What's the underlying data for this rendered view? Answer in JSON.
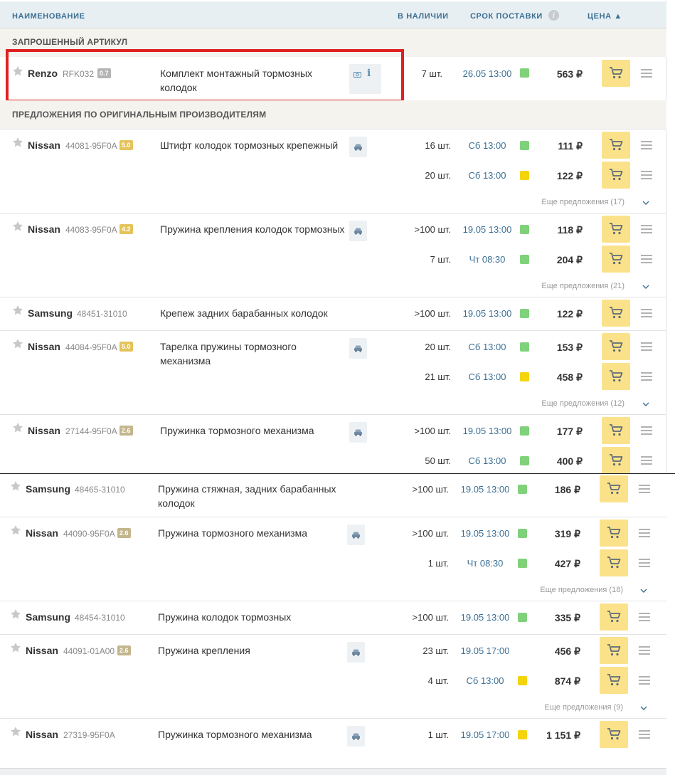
{
  "header": {
    "name": "НАИМЕНОВАНИЕ",
    "stock": "В НАЛИЧИИ",
    "delivery": "СРОК ПОСТАВКИ",
    "price": "ЦЕНА ▲"
  },
  "sections": {
    "requested": "ЗАПРОШЕННЫЙ АРТИКУЛ",
    "original": "ПРЕДЛОЖЕНИЯ ПО ОРИГИНАЛЬНЫМ ПРОИЗВОДИТЕЛЯМ"
  },
  "requested": {
    "brand": "Renzo",
    "code": "RFK032",
    "rating": "0.7",
    "desc": "Комплект монтажный тормозных колодок",
    "qty": "7 шт.",
    "date": "26.05 13:00",
    "price": "563 ₽"
  },
  "rows": [
    {
      "brand": "Nissan",
      "code": "44081-95F0A",
      "rating": "5.0",
      "desc": "Штифт колодок тормозных крепежный",
      "offers": [
        {
          "qty": "16 шт.",
          "date": "Сб 13:00",
          "price": "111 ₽"
        },
        {
          "qty": "20 шт.",
          "date": "Сб 13:00",
          "price": "122 ₽"
        }
      ],
      "more": "Еще предложения (17)"
    },
    {
      "brand": "Nissan",
      "code": "44083-95F0A",
      "rating": "4.2",
      "desc": "Пружина крепления колодок тормозных",
      "offers": [
        {
          "qty": ">100 шт.",
          "date": "19.05 13:00",
          "price": "118 ₽"
        },
        {
          "qty": "7 шт.",
          "date": "Чт 08:30",
          "price": "204 ₽"
        }
      ],
      "more": "Еще предложения (21)"
    },
    {
      "brand": "Samsung",
      "code": "48451-31010",
      "desc": "Крепеж задних барабанных колодок",
      "offers": [
        {
          "qty": ">100 шт.",
          "date": "19.05 13:00",
          "price": "122 ₽"
        }
      ]
    },
    {
      "brand": "Nissan",
      "code": "44084-95F0A",
      "rating": "5.0",
      "desc": "Тарелка пружины тормозного механизма",
      "offers": [
        {
          "qty": "20 шт.",
          "date": "Сб 13:00",
          "price": "153 ₽"
        },
        {
          "qty": "21 шт.",
          "date": "Сб 13:00",
          "price": "458 ₽"
        }
      ],
      "more": "Еще предложения (12)"
    },
    {
      "brand": "Nissan",
      "code": "27144-95F0A",
      "rating": "2.6",
      "desc": "Пружинка тормозного механизма",
      "offers": [
        {
          "qty": ">100 шт.",
          "date": "19.05 13:00",
          "price": "177 ₽"
        },
        {
          "qty": "50 шт.",
          "date": "Сб 13:00",
          "price": "400 ₽"
        }
      ]
    },
    {
      "brand": "Samsung",
      "code": "48465-31010",
      "desc": "Пружина стяжная, задних барабанных колодок",
      "offers": [
        {
          "qty": ">100 шт.",
          "date": "19.05 13:00",
          "price": "186 ₽"
        }
      ]
    },
    {
      "brand": "Nissan",
      "code": "44090-95F0A",
      "rating": "2.6",
      "desc": "Пружина тормозного механизма",
      "offers": [
        {
          "qty": ">100 шт.",
          "date": "19.05 13:00",
          "price": "319 ₽"
        },
        {
          "qty": "1 шт.",
          "date": "Чт 08:30",
          "price": "427 ₽"
        }
      ],
      "more": "Еще предложения (18)"
    },
    {
      "brand": "Samsung",
      "code": "48454-31010",
      "desc": "Пружина колодок тормозных",
      "offers": [
        {
          "qty": ">100 шт.",
          "date": "19.05 13:00",
          "price": "335 ₽"
        }
      ]
    },
    {
      "brand": "Nissan",
      "code": "44091-01A00",
      "rating": "2.6",
      "desc": "Пружина крепления",
      "offers": [
        {
          "qty": "23 шт.",
          "date": "19.05 17:00",
          "price": "456 ₽"
        },
        {
          "qty": "4 шт.",
          "date": "Сб 13:00",
          "price": "874 ₽"
        }
      ],
      "more": "Еще предложения (9)"
    },
    {
      "brand": "Nissan",
      "code": "27319-95F0A",
      "desc": "Пружинка тормозного механизма",
      "offers": [
        {
          "qty": "1 шт.",
          "date": "19.05 17:00",
          "price": "1 151 ₽"
        }
      ]
    }
  ],
  "colors": {
    "accent": "#3b6f94",
    "cart": "#fbe28a",
    "green": "#7fd17a",
    "yellow": "#f4d40a",
    "highlight": "#e02020"
  }
}
